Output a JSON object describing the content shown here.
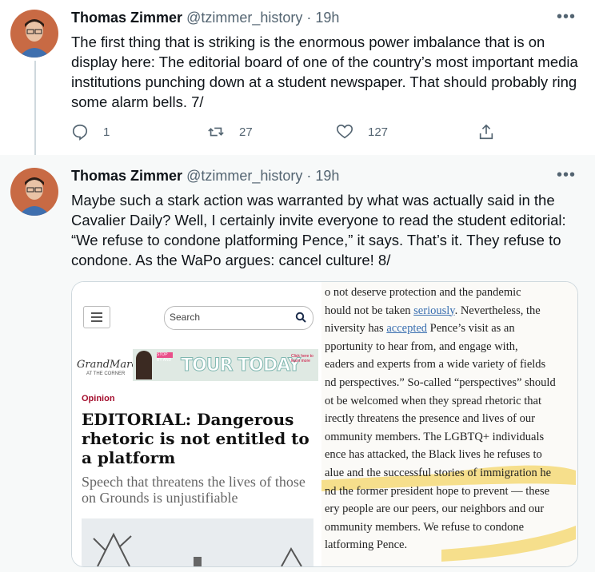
{
  "tweets": [
    {
      "name": "Thomas Zimmer",
      "handle": "@tzimmer_history",
      "time": "19h",
      "text": "The first thing that is striking is the enormous power imbalance that is on display here: The editorial board of one of the country’s most important media institutions punching down at a student newspaper. That should probably ring some alarm bells. 7/",
      "replies": "1",
      "retweets": "27",
      "likes": "127"
    },
    {
      "name": "Thomas Zimmer",
      "handle": "@tzimmer_history",
      "time": "19h",
      "text": "Maybe such a stark action was warranted by what was actually said in the Cavalier Daily? Well, I certainly invite everyone to read the student editorial: “We refuse to condone platforming Pence,” it says. That’s it. They refuse to condone. As the WaPo argues: cancel culture! 8/"
    }
  ],
  "card": {
    "search_placeholder": "Search",
    "ad_brand": "GrandMarc",
    "ad_brand_sub": "AT THE CORNER",
    "ad_stop": "STOP BY AND",
    "ad_tour": "TOUR TODAY",
    "ad_click": "Click here to learn more",
    "opinion": "Opinion",
    "headline": "EDITORIAL: Dangerous rhetoric is not entitled to a platform",
    "subheadline": "Speech that threatens the lives of those on Grounds is unjustifiable",
    "article_lines": [
      "o not deserve protection and the pandemic",
      "hould not be taken ",
      "niversity has ",
      "pportunity to hear from, and engage with,",
      "eaders and experts from a wide variety of fields",
      "nd perspectives.” So-called “perspectives” should",
      "ot be welcomed when they spread rhetoric that",
      "irectly threatens the presence and lives of our",
      "ommunity members. The LGBTQ+ individuals",
      "ence has attacked, the Black lives he refuses to",
      "alue and the successful stories of immigration he",
      "nd the former president hope to prevent — these",
      "ery people are our peers, our neighbors and our",
      "ommunity members. We refuse to condone",
      "latforming Pence."
    ],
    "link_seriously": "seriously",
    "after_seriously": ". Nevertheless, the",
    "link_accepted": "accepted",
    "after_accepted": " Pence’s visit as an"
  },
  "colors": {
    "accent": "#1d9bf0",
    "muted": "#536471",
    "highlight": "#f4d35e"
  }
}
